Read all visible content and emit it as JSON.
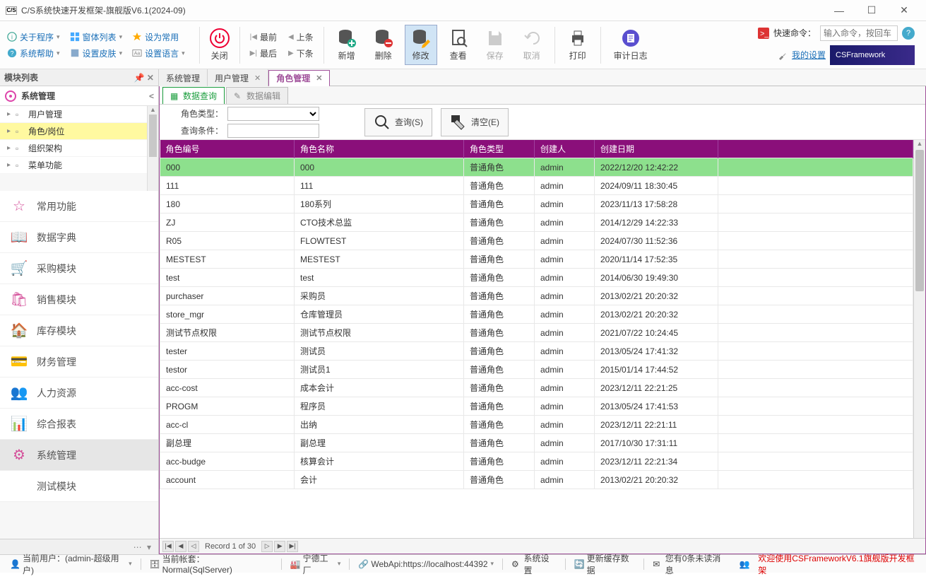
{
  "window": {
    "title": "C/S系统快速开发框架-旗舰版V6.1(2024-09)"
  },
  "toolbar": {
    "left": {
      "about": "关于程序",
      "forms": "窗体列表",
      "fav": "设为常用",
      "help": "系统帮助",
      "skin": "设置皮肤",
      "lang": "设置语言"
    },
    "close": "关闭",
    "nav": {
      "first": "最前",
      "prev": "上条",
      "last": "最后",
      "next": "下条"
    },
    "big": {
      "add": "新增",
      "del": "删除",
      "edit": "修改",
      "view": "查看",
      "save": "保存",
      "cancel": "取消",
      "print": "打印",
      "audit": "审计日志"
    },
    "right": {
      "cmd": "快速命令：",
      "placeholder": "输入命令，按回车",
      "settings": "我的设置",
      "brand": "CSFramework"
    }
  },
  "sidebar": {
    "header": "模块列表",
    "section": "系统管理",
    "tree": [
      "用户管理",
      "角色/岗位",
      "组织架构",
      "菜单功能"
    ],
    "selected": 1,
    "mods": [
      "常用功能",
      "数据字典",
      "采购模块",
      "销售模块",
      "库存模块",
      "财务管理",
      "人力资源",
      "综合报表",
      "系统管理",
      "测试模块"
    ],
    "mod_active": 8
  },
  "tabs": {
    "items": [
      "系统管理",
      "用户管理",
      "角色管理"
    ],
    "active": 2
  },
  "subtabs": {
    "items": [
      "数据查询",
      "数据编辑"
    ],
    "active": 0
  },
  "filters": {
    "type_label": "角色类型：",
    "cond_label": "查询条件：",
    "search": "查询(S)",
    "clear": "清空(E)"
  },
  "grid": {
    "headers": [
      "角色编号",
      "角色名称",
      "角色类型",
      "创建人",
      "创建日期"
    ],
    "rows": [
      [
        "000",
        "000",
        "普通角色",
        "admin",
        "2022/12/20 12:42:22"
      ],
      [
        "111",
        "111",
        "普通角色",
        "admin",
        "2024/09/11 18:30:45"
      ],
      [
        "180",
        "180系列",
        "普通角色",
        "admin",
        "2023/11/13 17:58:28"
      ],
      [
        "ZJ",
        "CTO技术总监",
        "普通角色",
        "admin",
        "2014/12/29 14:22:33"
      ],
      [
        "R05",
        "FLOWTEST",
        "普通角色",
        "admin",
        "2024/07/30 11:52:36"
      ],
      [
        "MESTEST",
        "MESTEST",
        "普通角色",
        "admin",
        "2020/11/14 17:52:35"
      ],
      [
        "test",
        "test",
        "普通角色",
        "admin",
        "2014/06/30 19:49:30"
      ],
      [
        "purchaser",
        "采购员",
        "普通角色",
        "admin",
        "2013/02/21 20:20:32"
      ],
      [
        "store_mgr",
        "仓库管理员",
        "普通角色",
        "admin",
        "2013/02/21 20:20:32"
      ],
      [
        "测试节点权限",
        "测试节点权限",
        "普通角色",
        "admin",
        "2021/07/22 10:24:45"
      ],
      [
        "tester",
        "测试员",
        "普通角色",
        "admin",
        "2013/05/24 17:41:32"
      ],
      [
        "testor",
        "测试员1",
        "普通角色",
        "admin",
        "2015/01/14 17:44:52"
      ],
      [
        "acc-cost",
        "成本会计",
        "普通角色",
        "admin",
        "2023/12/11 22:21:25"
      ],
      [
        "PROGM",
        "程序员",
        "普通角色",
        "admin",
        "2013/05/24 17:41:53"
      ],
      [
        "acc-cl",
        "出纳",
        "普通角色",
        "admin",
        "2023/12/11 22:21:11"
      ],
      [
        "副总理",
        "副总理",
        "普通角色",
        "admin",
        "2017/10/30 17:31:11"
      ],
      [
        "acc-budge",
        "核算会计",
        "普通角色",
        "admin",
        "2023/12/11 22:21:34"
      ],
      [
        "account",
        "会计",
        "普通角色",
        "admin",
        "2013/02/21 20:20:32"
      ]
    ],
    "recnav": "Record 1 of 30"
  },
  "status": {
    "user": "当前用户：(admin-超级用户)",
    "acct": "当前帐套： Normal(SqlServer)",
    "factory": "宁德工厂",
    "webapi": "WebApi:https://localhost:44392",
    "sys": "系统设置",
    "cache": "更新缓存数据",
    "msg": "您有0条未读消息",
    "welcome": "欢迎使用CSFrameworkV6.1旗舰版开发框架"
  }
}
